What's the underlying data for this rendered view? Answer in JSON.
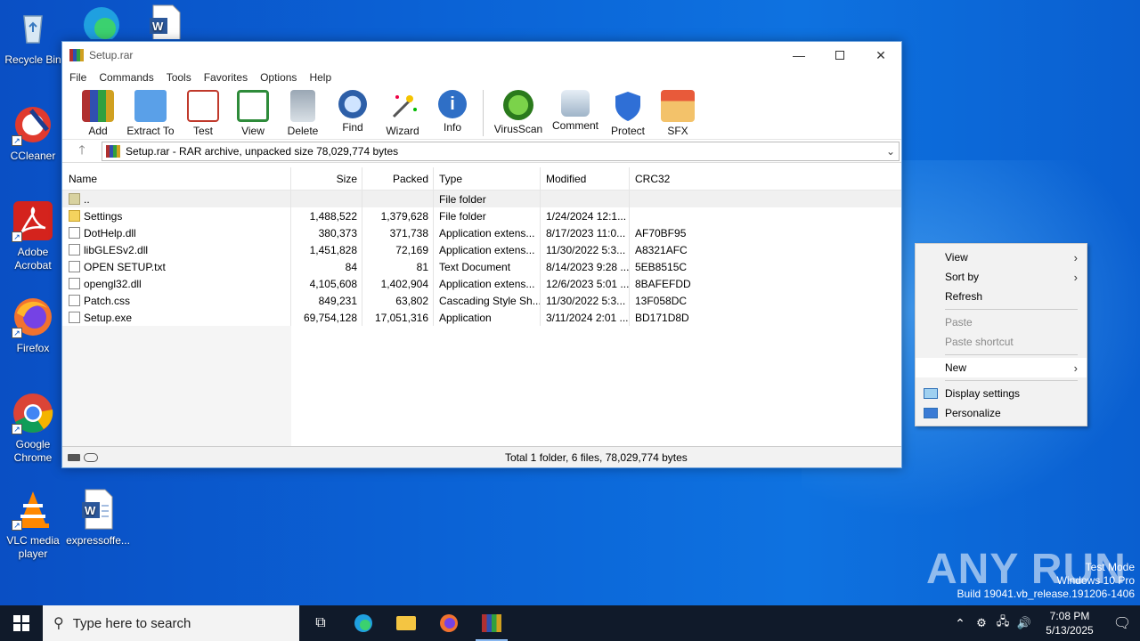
{
  "desktop": {
    "icons": [
      {
        "label": "Recycle Bin",
        "icon": "recycle-bin-icon"
      },
      {
        "label": "CCleaner",
        "icon": "ccleaner-icon"
      },
      {
        "label": "Adobe Acrobat",
        "icon": "adobe-acrobat-icon"
      },
      {
        "label": "Firefox",
        "icon": "firefox-icon"
      },
      {
        "label": "Google Chrome",
        "icon": "chrome-icon"
      },
      {
        "label": "VLC media player",
        "icon": "vlc-icon"
      },
      {
        "label": "expressoffe...",
        "icon": "word-document-icon"
      }
    ]
  },
  "window": {
    "title": "Setup.rar",
    "menu": [
      "File",
      "Commands",
      "Tools",
      "Favorites",
      "Options",
      "Help"
    ],
    "toolbar": [
      "Add",
      "Extract To",
      "Test",
      "View",
      "Delete",
      "Find",
      "Wizard",
      "Info",
      "VirusScan",
      "Comment",
      "Protect",
      "SFX"
    ],
    "address": "Setup.rar - RAR archive, unpacked size 78,029,774 bytes",
    "columns": {
      "name": "Name",
      "size": "Size",
      "packed": "Packed",
      "type": "Type",
      "modified": "Modified",
      "crc": "CRC32"
    },
    "files": [
      {
        "name": "..",
        "size": "",
        "packed": "",
        "type": "File folder",
        "modified": "",
        "crc": "",
        "icon": "up"
      },
      {
        "name": "Settings",
        "size": "1,488,522",
        "packed": "1,379,628",
        "type": "File folder",
        "modified": "1/24/2024 12:1...",
        "crc": "",
        "icon": "folder"
      },
      {
        "name": "DotHelp.dll",
        "size": "380,373",
        "packed": "371,738",
        "type": "Application extens...",
        "modified": "8/17/2023 11:0...",
        "crc": "AF70BF95",
        "icon": "file"
      },
      {
        "name": "libGLESv2.dll",
        "size": "1,451,828",
        "packed": "72,169",
        "type": "Application extens...",
        "modified": "11/30/2022 5:3...",
        "crc": "A8321AFC",
        "icon": "file"
      },
      {
        "name": "OPEN SETUP.txt",
        "size": "84",
        "packed": "81",
        "type": "Text Document",
        "modified": "8/14/2023 9:28 ...",
        "crc": "5EB8515C",
        "icon": "file"
      },
      {
        "name": "opengl32.dll",
        "size": "4,105,608",
        "packed": "1,402,904",
        "type": "Application extens...",
        "modified": "12/6/2023 5:01 ...",
        "crc": "8BAFEFDD",
        "icon": "file"
      },
      {
        "name": "Patch.css",
        "size": "849,231",
        "packed": "63,802",
        "type": "Cascading Style Sh...",
        "modified": "11/30/2022 5:3...",
        "crc": "13F058DC",
        "icon": "file"
      },
      {
        "name": "Setup.exe",
        "size": "69,754,128",
        "packed": "17,051,316",
        "type": "Application",
        "modified": "3/11/2024 2:01 ...",
        "crc": "BD171D8D",
        "icon": "exe"
      }
    ],
    "status": "Total 1 folder, 6 files, 78,029,774 bytes"
  },
  "context_menu": {
    "view": "View",
    "sort_by": "Sort by",
    "refresh": "Refresh",
    "paste": "Paste",
    "paste_shortcut": "Paste shortcut",
    "new": "New",
    "display_settings": "Display settings",
    "personalize": "Personalize"
  },
  "taskbar": {
    "search_placeholder": "Type here to search",
    "time": "7:08 PM",
    "date": "5/13/2025"
  },
  "watermark": {
    "brand": "ANY RUN",
    "line1": "Test Mode",
    "line2": "Windows 10 Pro",
    "line3": "Build 19041.vb_release.191206-1406"
  }
}
